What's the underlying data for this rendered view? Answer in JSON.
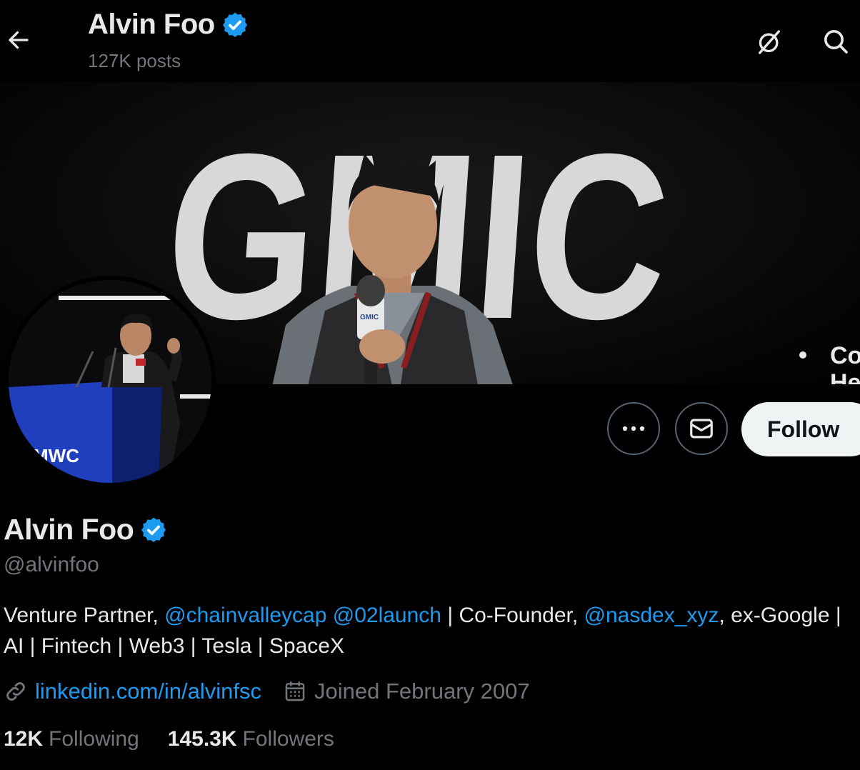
{
  "header": {
    "name": "Alvin Foo",
    "posts_count": "127K posts"
  },
  "banner": {
    "logo_text": "GMIC",
    "mic_label": "GMIC",
    "bullet_text_1": "Co",
    "bullet_text_2": "He"
  },
  "avatar": {
    "podium_text": "MWC"
  },
  "actions": {
    "follow_label": "Follow"
  },
  "profile": {
    "name": "Alvin Foo",
    "handle": "@alvinfoo",
    "bio": {
      "part1": "Venture Partner, ",
      "mention1": "@chainvalleycap",
      "space1": " ",
      "mention2": "@02launch",
      "part2": " | Co-Founder, ",
      "mention3": "@nasdex_xyz",
      "part3": ", ex-Google | AI | Fintech | Web3 | Tesla | SpaceX"
    },
    "website": "linkedin.com/in/alvinfsc",
    "joined": "Joined February 2007"
  },
  "stats": {
    "following_count": "12K",
    "following_label": "Following",
    "followers_count": "145.3K",
    "followers_label": "Followers"
  },
  "colors": {
    "background": "#000000",
    "accent": "#1d9bf0",
    "text_primary": "#e7e9ea",
    "text_secondary": "#71767b",
    "verified": "#1d9bf0",
    "follow_bg": "#eff3f4"
  },
  "icons": {
    "back": "arrow-left-icon",
    "grok": "grok-icon",
    "search": "search-icon",
    "verified": "verified-badge-icon",
    "more": "more-dots-icon",
    "message": "envelope-icon",
    "link": "link-icon",
    "calendar": "calendar-icon"
  }
}
